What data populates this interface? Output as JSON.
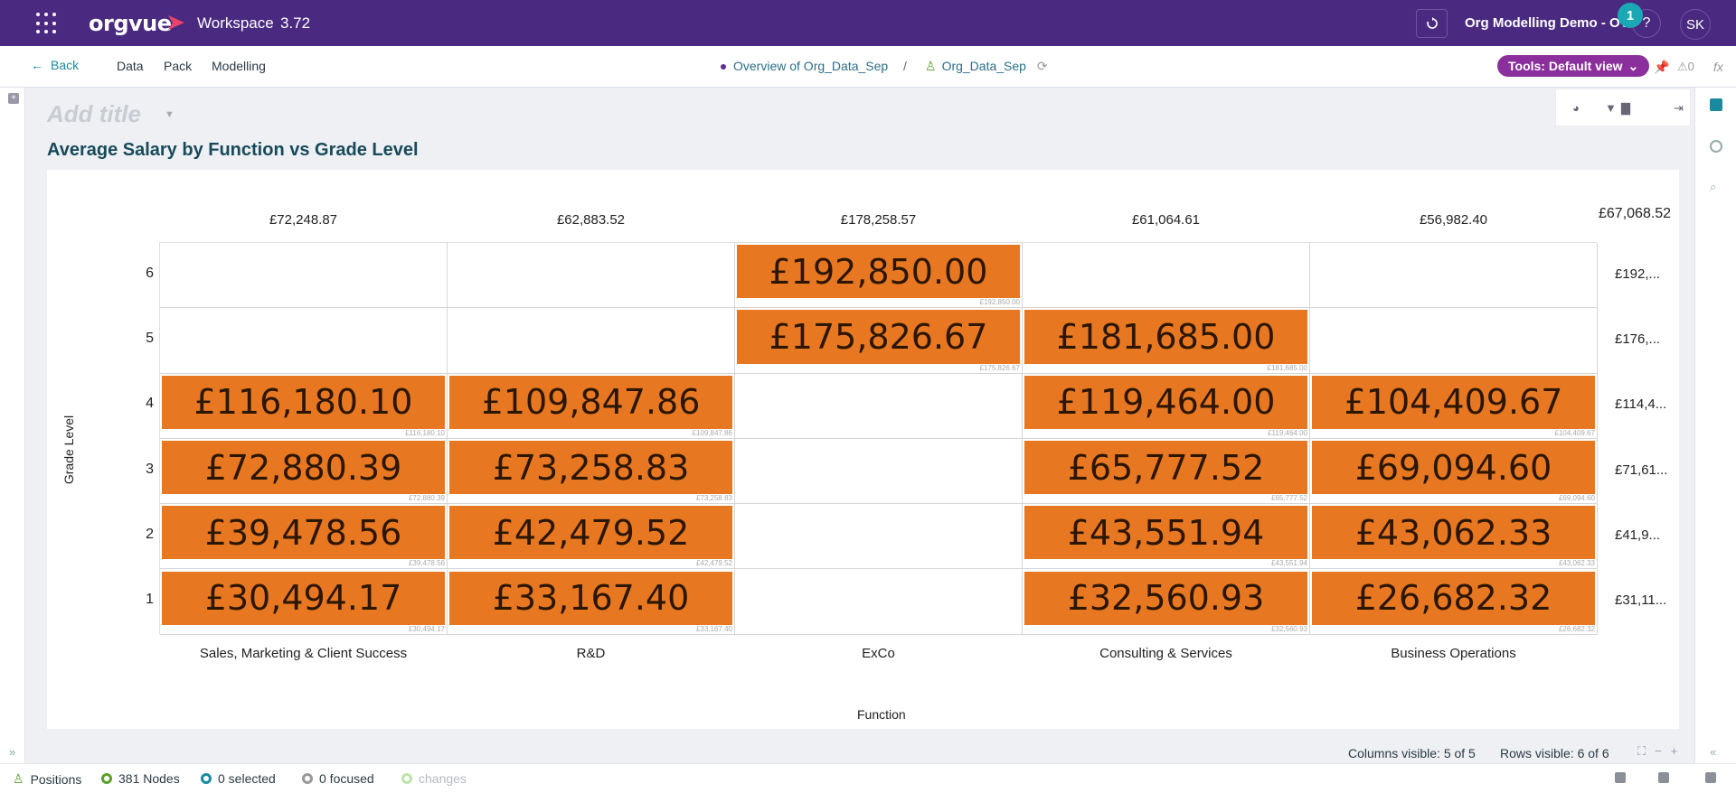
{
  "app": {
    "brand": "orgvue",
    "workspace_name": "Workspace",
    "version": "3.72",
    "project_name": "Org Modelling Demo - OV",
    "help_label": "?",
    "notification_count": "1",
    "user_initials": "SK",
    "brand_color": "#4a2a80",
    "accent_color": "#e87722"
  },
  "subbar": {
    "back_label": "Back",
    "nav": [
      "Data",
      "Pack",
      "Modelling"
    ],
    "breadcrumb_view": "Overview of Org_Data_Sep",
    "breadcrumb_sep": "/",
    "breadcrumb_dataset": "Org_Data_Sep",
    "tools_label": "Tools: Default view",
    "alerts_count": "0",
    "fx_label": "fx"
  },
  "main": {
    "add_title": "Add title",
    "chart_title": "Average Salary by Function vs Grade Level"
  },
  "chart_data": {
    "type": "heatmap",
    "xlabel": "Function",
    "ylabel": "Grade Level",
    "columns": [
      "Sales, Marketing & Client Success",
      "R&D",
      "ExCo",
      "Consulting & Services",
      "Business Operations"
    ],
    "rows": [
      "6",
      "5",
      "4",
      "3",
      "2",
      "1"
    ],
    "column_totals": [
      "£72,248.87",
      "£62,883.52",
      "£178,258.57",
      "£61,064.61",
      "£56,982.40"
    ],
    "grand_total": "£67,068.52",
    "row_totals": [
      "£192,...",
      "£176,...",
      "£114,4...",
      "£71,61...",
      "£41,9...",
      "£31,11..."
    ],
    "cells": [
      [
        "",
        "",
        "£192,850.00",
        "",
        ""
      ],
      [
        "",
        "",
        "£175,826.67",
        "£181,685.00",
        ""
      ],
      [
        "£116,180.10",
        "£109,847.86",
        "",
        "£119,464.00",
        "£104,409.67"
      ],
      [
        "£72,880.39",
        "£73,258.83",
        "",
        "£65,777.52",
        "£69,094.60"
      ],
      [
        "£39,478.56",
        "£42,479.52",
        "",
        "£43,551.94",
        "£43,062.33"
      ],
      [
        "£30,494.17",
        "£33,167.40",
        "",
        "£32,560.93",
        "£26,682.32"
      ]
    ]
  },
  "footer": {
    "columns_visible": "Columns visible: 5 of 5",
    "rows_visible": "Rows visible: 6 of 6"
  },
  "status": {
    "positions": "Positions",
    "nodes": "381 Nodes",
    "selected": "0 selected",
    "focused": "0 focused",
    "changes": "changes"
  }
}
